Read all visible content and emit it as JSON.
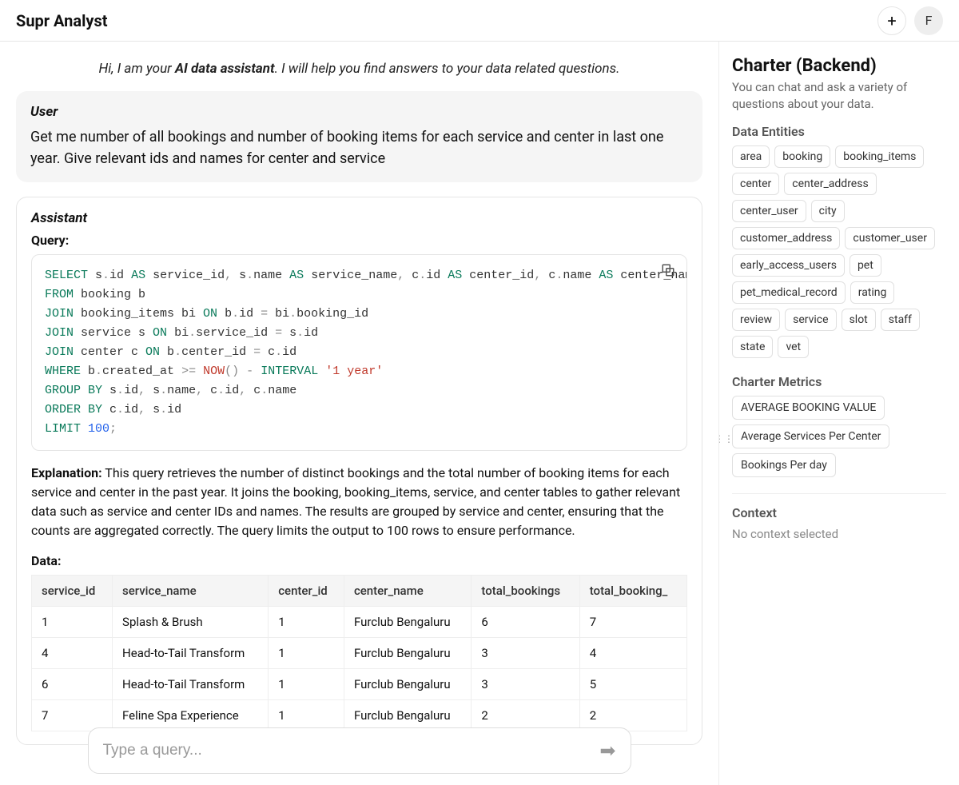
{
  "header": {
    "title": "Supr Analyst",
    "avatar_initial": "F"
  },
  "intro": {
    "prefix": "Hi, I am your ",
    "bold": "AI data assistant",
    "suffix": ". I will help you find answers to your data related questions."
  },
  "user": {
    "label": "User",
    "message": "Get me number of all bookings and number of booking items for each service and center in last one year. Give relevant ids and names for center and service"
  },
  "assistant": {
    "label": "Assistant",
    "query_label": "Query:",
    "explanation_label": "Explanation:",
    "explanation_text": " This query retrieves the number of distinct bookings and the total number of booking items for each service and center in the past year. It joins the booking, booking_items, service, and center tables to gather relevant data such as service and center IDs and names. The results are grouped by service and center, ensuring that the counts are aggregated correctly. The query limits the output to 100 rows to ensure performance.",
    "data_label": "Data:",
    "sql": {
      "line1": {
        "select": "SELECT",
        "body": " s",
        "dot1": ".",
        "id1": "id ",
        "as1": "AS",
        "sid": " service_id",
        "c1": ",",
        "body2": " s",
        "dot2": ".",
        "name1": "name ",
        "as2": "AS",
        "sname": " service_name",
        "c2": ",",
        "body3": " c",
        "dot3": ".",
        "id2": "id ",
        "as3": "AS",
        "cid": " center_id",
        "c3": ",",
        "body4": " c",
        "dot4": ".",
        "name2": "name ",
        "as4": "AS",
        "cname": " center_name",
        "c4": ","
      },
      "line2": {
        "from": "FROM",
        "body": " booking b"
      },
      "line3": {
        "join": "JOIN",
        "body": " booking_items bi ",
        "on": "ON",
        "body2": " b",
        "dot": ".",
        "id": "id ",
        "eq": "=",
        "body3": " bi",
        "dot2": ".",
        "bid": "booking_id"
      },
      "line4": {
        "join": "JOIN",
        "body": " service s ",
        "on": "ON",
        "body2": " bi",
        "dot": ".",
        "sid": "service_id ",
        "eq": "=",
        "body3": " s",
        "dot2": ".",
        "id": "id"
      },
      "line5": {
        "join": "JOIN",
        "body": " center c ",
        "on": "ON",
        "body2": " b",
        "dot": ".",
        "cid": "center_id ",
        "eq": "=",
        "body3": " c",
        "dot2": ".",
        "id": "id"
      },
      "line6": {
        "where": "WHERE",
        "body": " b",
        "dot": ".",
        "ca": "created_at ",
        "op": ">=",
        "sp": " ",
        "now": "NOW",
        "paren": "()",
        "sp2": " ",
        "minus": "-",
        "sp3": " ",
        "interval": "INTERVAL",
        "sp4": " ",
        "str": "'1 year'"
      },
      "line7": {
        "group": "GROUP",
        "by": " BY",
        "body": " s",
        "dot": ".",
        "id": "id",
        "c1": ",",
        "body2": " s",
        "dot2": ".",
        "name": "name",
        "c2": ",",
        "body3": " c",
        "dot3": ".",
        "id2": "id",
        "c3": ",",
        "body4": " c",
        "dot4": ".",
        "name2": "name"
      },
      "line8": {
        "order": "ORDER",
        "by": " BY",
        "body": " c",
        "dot": ".",
        "id": "id",
        "c1": ",",
        "body2": " s",
        "dot2": ".",
        "id2": "id"
      },
      "line9": {
        "limit": "LIMIT",
        "sp": " ",
        "num": "100",
        "semi": ";"
      }
    },
    "table": {
      "headers": [
        "service_id",
        "service_name",
        "center_id",
        "center_name",
        "total_bookings",
        "total_booking_"
      ],
      "rows": [
        [
          "1",
          "Splash & Brush",
          "1",
          "Furclub Bengaluru",
          "6",
          "7"
        ],
        [
          "4",
          "Head-to-Tail Transform",
          "1",
          "Furclub Bengaluru",
          "3",
          "4"
        ],
        [
          "6",
          "Head-to-Tail Transform",
          "1",
          "Furclub Bengaluru",
          "3",
          "5"
        ],
        [
          "7",
          "Feline Spa Experience",
          "1",
          "Furclub Bengaluru",
          "2",
          "2"
        ]
      ]
    }
  },
  "input": {
    "placeholder": "Type a query..."
  },
  "sidebar": {
    "title": "Charter (Backend)",
    "subtitle": "You can chat and ask a variety of questions about your data.",
    "entities_label": "Data Entities",
    "entities": [
      "area",
      "booking",
      "booking_items",
      "center",
      "center_address",
      "center_user",
      "city",
      "customer_address",
      "customer_user",
      "early_access_users",
      "pet",
      "pet_medical_record",
      "rating",
      "review",
      "service",
      "slot",
      "staff",
      "state",
      "vet"
    ],
    "metrics_label": "Charter Metrics",
    "metrics": [
      "AVERAGE BOOKING VALUE",
      "Average Services Per Center",
      "Bookings Per day"
    ],
    "context_label": "Context",
    "context_empty": "No context selected"
  }
}
